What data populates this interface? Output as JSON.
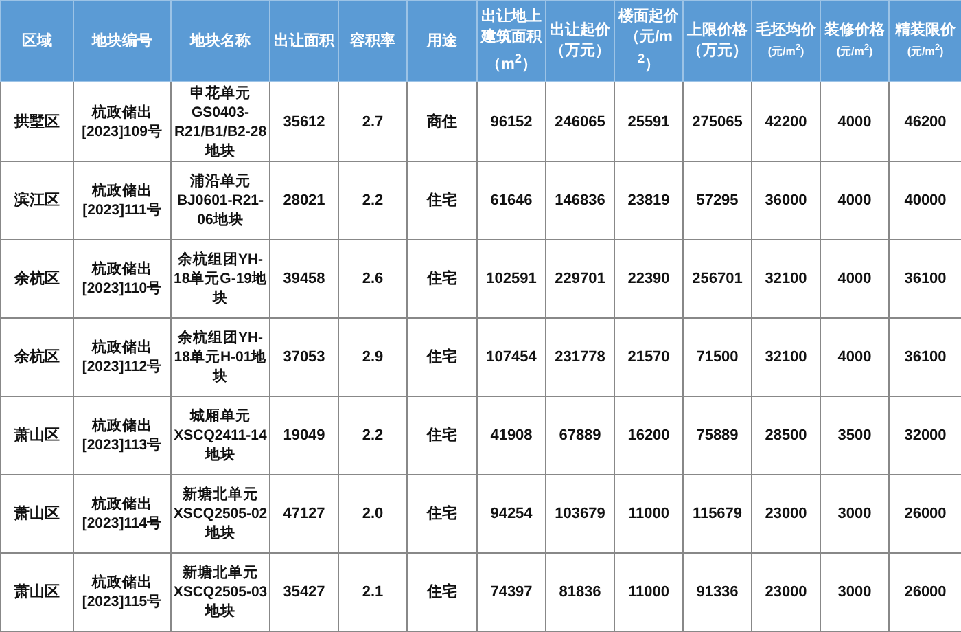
{
  "table": {
    "columns": [
      {
        "label": "区域"
      },
      {
        "label": "地块编号"
      },
      {
        "label": "地块名称"
      },
      {
        "label": "出让面积"
      },
      {
        "label": "容积率"
      },
      {
        "label": "用途"
      },
      {
        "label": "出让地上建筑面积",
        "unit": "（m$^{2}$）",
        "kind": "large"
      },
      {
        "label": "出让起价",
        "unit": "（万元）",
        "kind": "large"
      },
      {
        "label": "楼面起价",
        "unit": "（元/m$^{2}$）",
        "kind": "large"
      },
      {
        "label": "上限价格",
        "unit": "（万元）",
        "kind": "large"
      },
      {
        "label": "毛坯均价",
        "unit": "(元/m$^{2}$)",
        "kind": "small"
      },
      {
        "label": "装修价格",
        "unit": "(元/m$^{2}$)",
        "kind": "small"
      },
      {
        "label": "精装限价",
        "unit": "(元/m$^{2}$)",
        "kind": "small"
      }
    ],
    "rows": [
      [
        "拱墅区",
        "杭政储出[2023]109号",
        "申花单元GS0403-R21/B1/B2-28地块",
        "35612",
        "2.7",
        "商住",
        "96152",
        "246065",
        "25591",
        "275065",
        "42200",
        "4000",
        "46200"
      ],
      [
        "滨江区",
        "杭政储出[2023]111号",
        "浦沿单元BJ0601-R21-06地块",
        "28021",
        "2.2",
        "住宅",
        "61646",
        "146836",
        "23819",
        "57295",
        "36000",
        "4000",
        "40000"
      ],
      [
        "余杭区",
        "杭政储出[2023]110号",
        "余杭组团YH-18单元G-19地块",
        "39458",
        "2.6",
        "住宅",
        "102591",
        "229701",
        "22390",
        "256701",
        "32100",
        "4000",
        "36100"
      ],
      [
        "余杭区",
        "杭政储出[2023]112号",
        "余杭组团YH-18单元H-01地块",
        "37053",
        "2.9",
        "住宅",
        "107454",
        "231778",
        "21570",
        "71500",
        "32100",
        "4000",
        "36100"
      ],
      [
        "萧山区",
        "杭政储出[2023]113号",
        "城厢单元XSCQ2411-14地块",
        "19049",
        "2.2",
        "住宅",
        "41908",
        "67889",
        "16200",
        "75889",
        "28500",
        "3500",
        "32000"
      ],
      [
        "萧山区",
        "杭政储出[2023]114号",
        "新塘北单元XSCQ2505-02地块",
        "47127",
        "2.0",
        "住宅",
        "94254",
        "103679",
        "11000",
        "115679",
        "23000",
        "3000",
        "26000"
      ],
      [
        "萧山区",
        "杭政储出[2023]115号",
        "新塘北单元XSCQ2505-03地块",
        "35427",
        "2.1",
        "住宅",
        "74397",
        "81836",
        "11000",
        "91336",
        "23000",
        "3000",
        "26000"
      ]
    ]
  }
}
